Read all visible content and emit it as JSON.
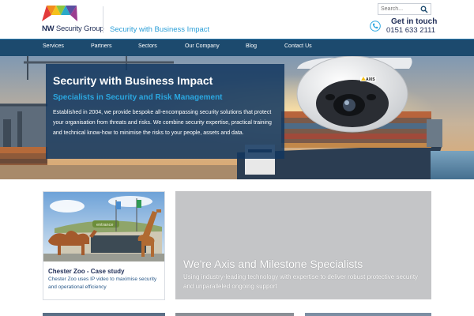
{
  "header": {
    "logo_text_bold": "NW",
    "logo_text_rest": " Security Group",
    "tagline": "Security with Business Impact",
    "search_placeholder": "Search...",
    "contact_title": "Get in touch",
    "contact_phone": "0151 633 2111"
  },
  "nav": {
    "items": [
      {
        "label": "Services"
      },
      {
        "label": "Partners"
      },
      {
        "label": "Sectors"
      },
      {
        "label": "Our Company"
      },
      {
        "label": "Blog"
      },
      {
        "label": "Contact Us"
      }
    ]
  },
  "hero": {
    "title": "Security with Business Impact",
    "subtitle": "Specialists in Security and Risk Management",
    "body": "Established in 2004, we provide bespoke all-encompassing security solutions that protect your organisation from threats and risks. We combine security expertise, practical training and technical know-how to minimise the risks to your people, assets and data.",
    "camera_brand": "AXIS"
  },
  "case_study": {
    "title": "Chester Zoo - Case study",
    "text": "Chester Zoo uses IP video to maximise security and operational efficiency",
    "sign_text": "entrance"
  },
  "promo": {
    "title": "We're Axis and Milestone Specialists",
    "text": "Using industry-leading technology with expertise to deliver robust protective security and unparalleled ongoing support"
  },
  "colors": {
    "nav_bg": "#1c4a6e",
    "accent_blue": "#2ba7e0",
    "navy": "#1f2d57",
    "promo_grey": "#c4c5c7"
  }
}
